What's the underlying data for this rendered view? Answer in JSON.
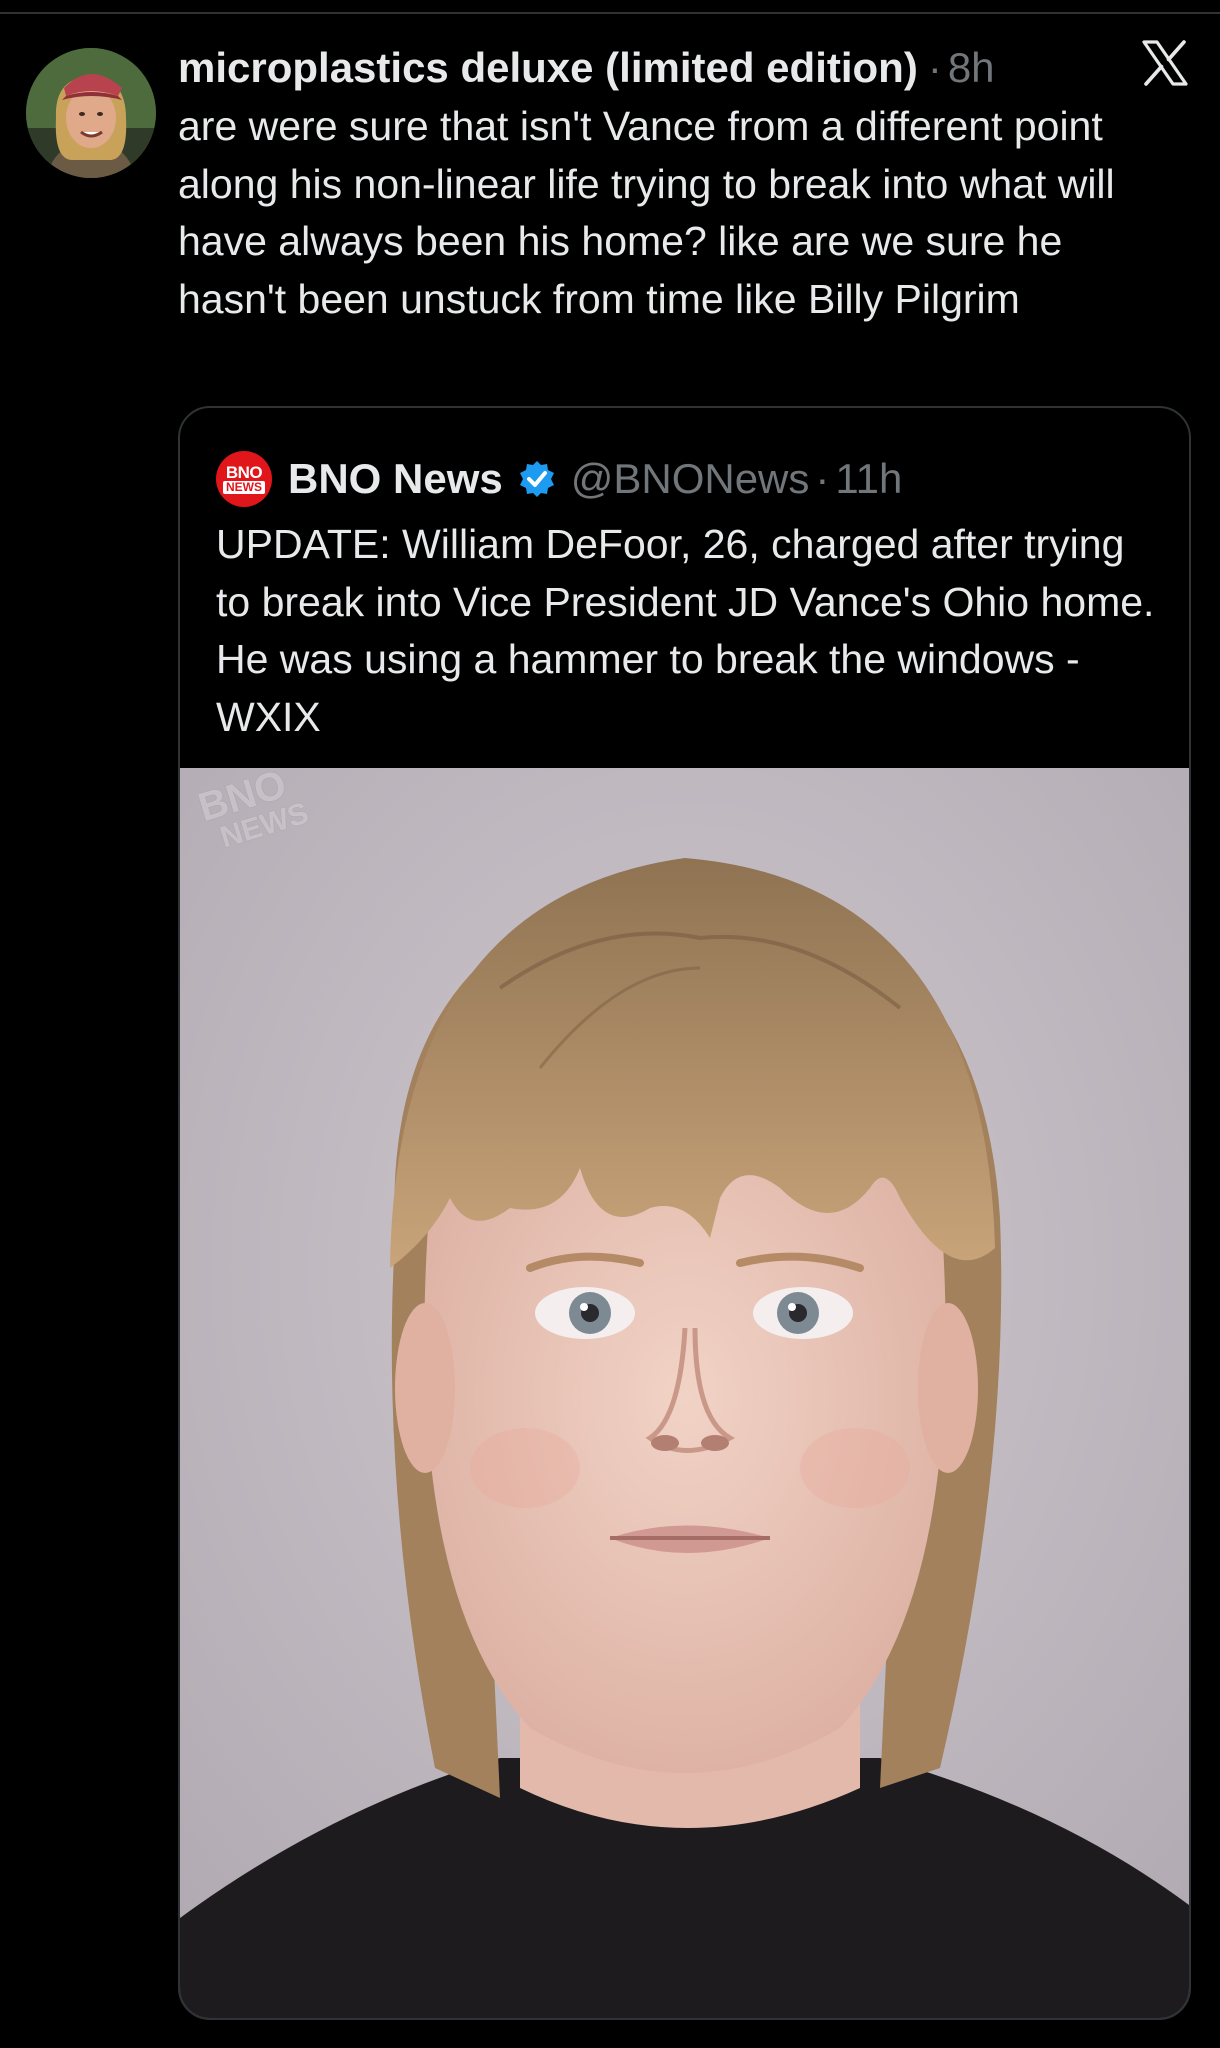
{
  "post": {
    "display_name": "microplastics deluxe (limited edition)",
    "separator": "·",
    "timestamp": "8h",
    "text": "are were sure that isn't Vance from a different point along his non-linear life trying to break into what will have always been his home? like are we sure he hasn't been unstuck from time like Billy Pilgrim",
    "avatar_icon": "profile-photo",
    "platform_icon": "x-logo-icon"
  },
  "quoted_post": {
    "display_name": "BNO News",
    "avatar_label_top": "BNO",
    "avatar_label_bottom": "NEWS",
    "verified_icon": "verified-badge-icon",
    "handle": "@BNONews",
    "separator": "·",
    "timestamp": "11h",
    "text": "UPDATE: William DeFoor, 26, charged after trying to break into Vice President JD Vance's Ohio home. He was using a hammer to break the windows - WXIX",
    "media": {
      "watermark_top": "BNO",
      "watermark_bottom": "NEWS"
    }
  },
  "colors": {
    "background": "#000000",
    "primary_text": "#e7e9ea",
    "secondary_text": "#71767b",
    "border": "#2f3336",
    "verified_blue": "#1d9bf0",
    "bno_red": "#e0161b"
  }
}
